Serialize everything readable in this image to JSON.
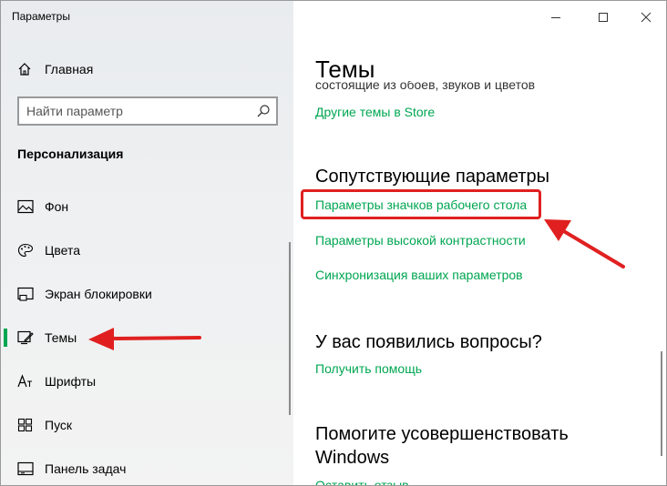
{
  "window": {
    "title": "Параметры"
  },
  "sidebar": {
    "home_label": "Главная",
    "search_placeholder": "Найти параметр",
    "section_title": "Персонализация",
    "items": [
      {
        "label": "Фон",
        "icon": "picture-icon"
      },
      {
        "label": "Цвета",
        "icon": "palette-icon"
      },
      {
        "label": "Экран блокировки",
        "icon": "lock-screen-icon"
      },
      {
        "label": "Темы",
        "icon": "themes-icon",
        "active": true
      },
      {
        "label": "Шрифты",
        "icon": "fonts-icon"
      },
      {
        "label": "Пуск",
        "icon": "start-icon"
      },
      {
        "label": "Панель задач",
        "icon": "taskbar-icon"
      }
    ]
  },
  "main": {
    "title": "Темы",
    "clipped_description": "состоящие из обоев, звуков и цветов",
    "store_link": "Другие темы в Store",
    "related_heading": "Сопутствующие параметры",
    "related_links": [
      "Параметры значков рабочего стола",
      "Параметры высокой контрастности",
      "Синхронизация ваших параметров"
    ],
    "questions_heading": "У вас появились вопросы?",
    "help_link": "Получить помощь",
    "improve_heading_line1": "Помогите усовершенствовать",
    "improve_heading_line2": "Windows",
    "feedback_link": "Оставить отзыв"
  },
  "colors": {
    "accent": "#00a651",
    "annotation": "#e02020"
  }
}
